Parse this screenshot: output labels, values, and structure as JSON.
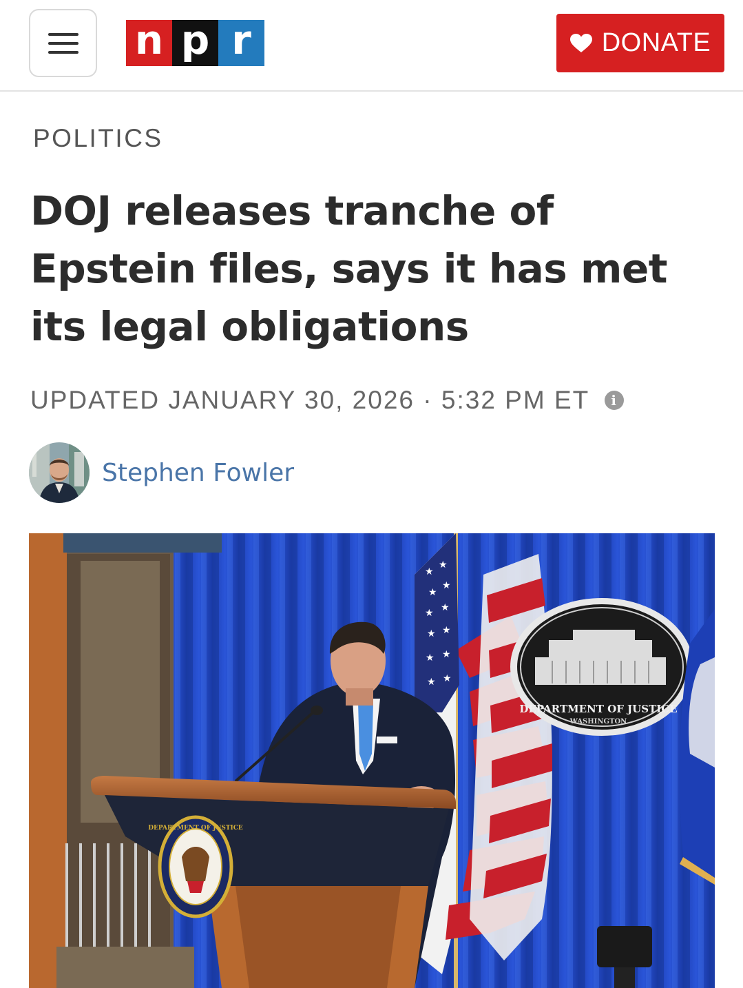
{
  "header": {
    "menu_icon": "hamburger-menu-icon",
    "logo_letters": [
      "n",
      "p",
      "r"
    ],
    "donate_label": "DONATE",
    "donate_icon": "heart-icon",
    "colors": {
      "brand_red": "#d62021",
      "brand_black": "#111111",
      "brand_blue": "#237bbd"
    }
  },
  "article": {
    "section": "POLITICS",
    "headline": "DOJ releases tranche of Epstein files, says it has met its legal obligations",
    "updated": "UPDATED JANUARY 30, 2026 · 5:32 PM ET",
    "info_icon": "info-icon",
    "author": "Stephen Fowler",
    "author_color": "#4a75a8"
  },
  "photo": {
    "seal_text": "DEPARTMENT OF JUSTICE",
    "seal_subtext": "WASHINGTON",
    "podium_seal_text": "DEPARTMENT OF JUSTICE"
  }
}
